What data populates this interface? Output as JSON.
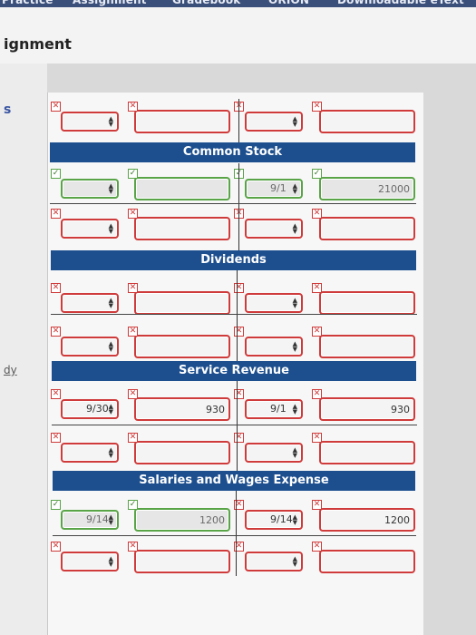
{
  "nav": {
    "tabs": [
      "Practice",
      "Assignment",
      "Gradebook",
      "ORION",
      "Downloadable eText"
    ]
  },
  "page": {
    "title": "ignment",
    "side_s": "s",
    "side_dy": "dy"
  },
  "headers": {
    "common_stock": "Common Stock",
    "dividends": "Dividends",
    "service_revenue": "Service Revenue",
    "salaries_wages": "Salaries and Wages Expense"
  },
  "rows": [
    {
      "status": [
        "x",
        "x",
        "x",
        "x"
      ],
      "left_date": "",
      "left_amount": "",
      "right_date": "",
      "right_amount": ""
    },
    {
      "status": [
        "ok",
        "ok",
        "ok",
        "ok"
      ],
      "left_date": "",
      "left_amount": "",
      "right_date": "9/1",
      "right_amount": "21000"
    },
    {
      "status": [
        "x",
        "x",
        "x",
        "x"
      ],
      "left_date": "",
      "left_amount": "",
      "right_date": "",
      "right_amount": ""
    },
    {
      "status": [
        "x",
        "x",
        "x",
        "x"
      ],
      "left_date": "",
      "left_amount": "",
      "right_date": "",
      "right_amount": ""
    },
    {
      "status": [
        "x",
        "x",
        "x",
        "x"
      ],
      "left_date": "",
      "left_amount": "",
      "right_date": "",
      "right_amount": ""
    },
    {
      "status": [
        "x",
        "x",
        "x",
        "x"
      ],
      "left_date": "9/30",
      "left_amount": "930",
      "right_date": "9/1",
      "right_amount": "930"
    },
    {
      "status": [
        "x",
        "x",
        "x",
        "x"
      ],
      "left_date": "",
      "left_amount": "",
      "right_date": "",
      "right_amount": ""
    },
    {
      "status": [
        "ok",
        "ok",
        "x",
        "x"
      ],
      "left_date": "9/14",
      "left_amount": "1200",
      "right_date": "9/14",
      "right_amount": "1200"
    },
    {
      "status": [
        "x",
        "x",
        "x",
        "x"
      ],
      "left_date": "",
      "left_amount": "",
      "right_date": "",
      "right_amount": ""
    }
  ],
  "icons": {
    "check": "✓",
    "cross": "✕",
    "arrows": "▲▼"
  },
  "colors": {
    "header_blue": "#1d4f8f",
    "nav_blue": "#3a4f7a",
    "error_red": "#cf3a3a",
    "correct_green": "#59a447"
  }
}
